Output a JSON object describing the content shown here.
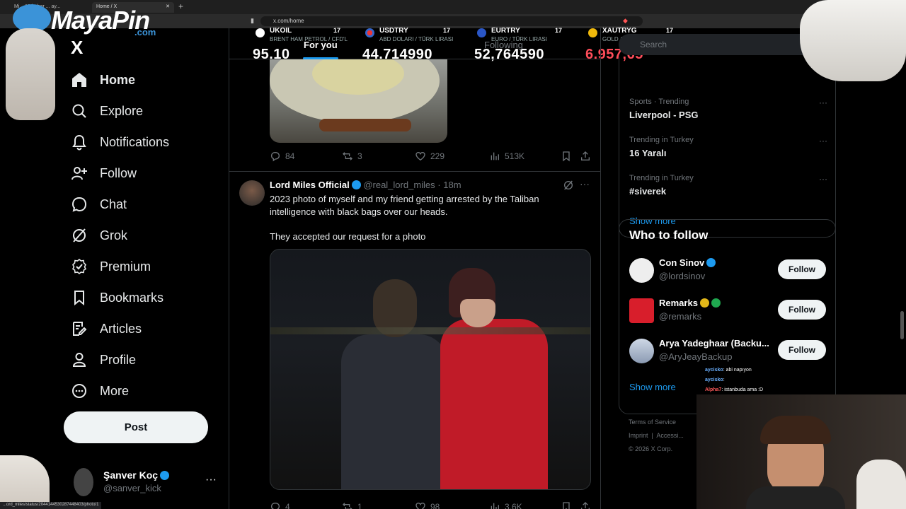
{
  "browser": {
    "tabs": [
      {
        "label": "Mi... 13 haber ... ay..."
      },
      {
        "label": "Home / X"
      }
    ],
    "new_tab": "+",
    "url": "x.com/home",
    "status_url": "...ord_miles/status/2044144530287448403/photo/1"
  },
  "stream_overlay": {
    "logo_text": "MayaPin",
    "logo_suffix": ".com",
    "tickers": [
      {
        "symbol": "UKOIL",
        "subtitle": "BRENT HAM PETROL / CFD'L",
        "value": "95,10",
        "color": "#ffffff"
      },
      {
        "symbol": "USDTRY",
        "subtitle": "ABD DOLARI / TÜRK LIRASI",
        "value": "44,714990",
        "color": "#ffffff"
      },
      {
        "symbol": "EURTRY",
        "subtitle": "EURO / TÜRK LIRASI",
        "value": "52,764590",
        "color": "#ffffff"
      },
      {
        "symbol": "XAUTRYG",
        "subtitle": "GOLD / TURKISH LIRA GRA",
        "value": "6.957,65",
        "color": "#ff4d5a"
      }
    ],
    "chat": [
      {
        "user": "aycisko",
        "message": ": abi napıyon"
      },
      {
        "user": "aycisko",
        "message": ":"
      },
      {
        "user": "Alpha7",
        "message": ": istanbuda ama :D"
      }
    ]
  },
  "nav": {
    "logo": "X",
    "items": [
      {
        "label": "Home",
        "icon": "home-icon",
        "active": true
      },
      {
        "label": "Explore",
        "icon": "search-icon"
      },
      {
        "label": "Notifications",
        "icon": "bell-icon"
      },
      {
        "label": "Follow",
        "icon": "add-person-icon"
      },
      {
        "label": "Chat",
        "icon": "chat-icon"
      },
      {
        "label": "Grok",
        "icon": "grok-icon"
      },
      {
        "label": "Premium",
        "icon": "premium-icon"
      },
      {
        "label": "Bookmarks",
        "icon": "bookmark-icon"
      },
      {
        "label": "Articles",
        "icon": "articles-icon"
      },
      {
        "label": "Profile",
        "icon": "person-icon"
      },
      {
        "label": "More",
        "icon": "more-circle-icon"
      }
    ],
    "post_label": "Post",
    "account": {
      "name": "Şanver Koç",
      "handle": "@sanver_kick",
      "menu": "···"
    }
  },
  "feed": {
    "tabs": [
      {
        "label": "For you",
        "active": true
      },
      {
        "label": "Following"
      }
    ],
    "prev_tweet": {
      "replies": "84",
      "reposts": "3",
      "likes": "229",
      "views": "513K"
    },
    "tweet": {
      "name": "Lord Miles Official",
      "handle": "@real_lord_miles",
      "time": "· 18m",
      "text_1": "2023 photo of myself and my friend getting arrested by the Taliban intelligence with black bags over our heads.",
      "text_2": "They accepted our request for a photo",
      "replies": "4",
      "reposts": "1",
      "likes": "98",
      "views": "3.6K"
    }
  },
  "right": {
    "search_placeholder": "Search",
    "trends": [
      {
        "category": "Sports · Trending",
        "title": "Liverpool - PSG"
      },
      {
        "category": "Trending in Turkey",
        "title": "16 Yaralı"
      },
      {
        "category": "Trending in Turkey",
        "title": "#siverek"
      }
    ],
    "trends_show_more": "Show more",
    "who_title": "Who to follow",
    "who": [
      {
        "name": "Con Sinov",
        "handle": "@lordsinov",
        "button": "Follow",
        "badge": "blue"
      },
      {
        "name": "Remarks",
        "handle": "@remarks",
        "button": "Follow",
        "badge": "gold"
      },
      {
        "name": "Arya Yadeghaar (Backu...",
        "handle": "@AryJeayBackup",
        "button": "Follow",
        "badge": "none"
      }
    ],
    "who_show_more": "Show more",
    "footer": {
      "terms": "Terms of Service",
      "imprint": "Imprint",
      "sep": "|",
      "accessibility": "Accessi...",
      "copyright": "© 2026 X Corp."
    }
  },
  "colors": {
    "accent": "#1d9bf0",
    "background": "#000000",
    "border": "#2f3336",
    "muted": "#71767b"
  }
}
